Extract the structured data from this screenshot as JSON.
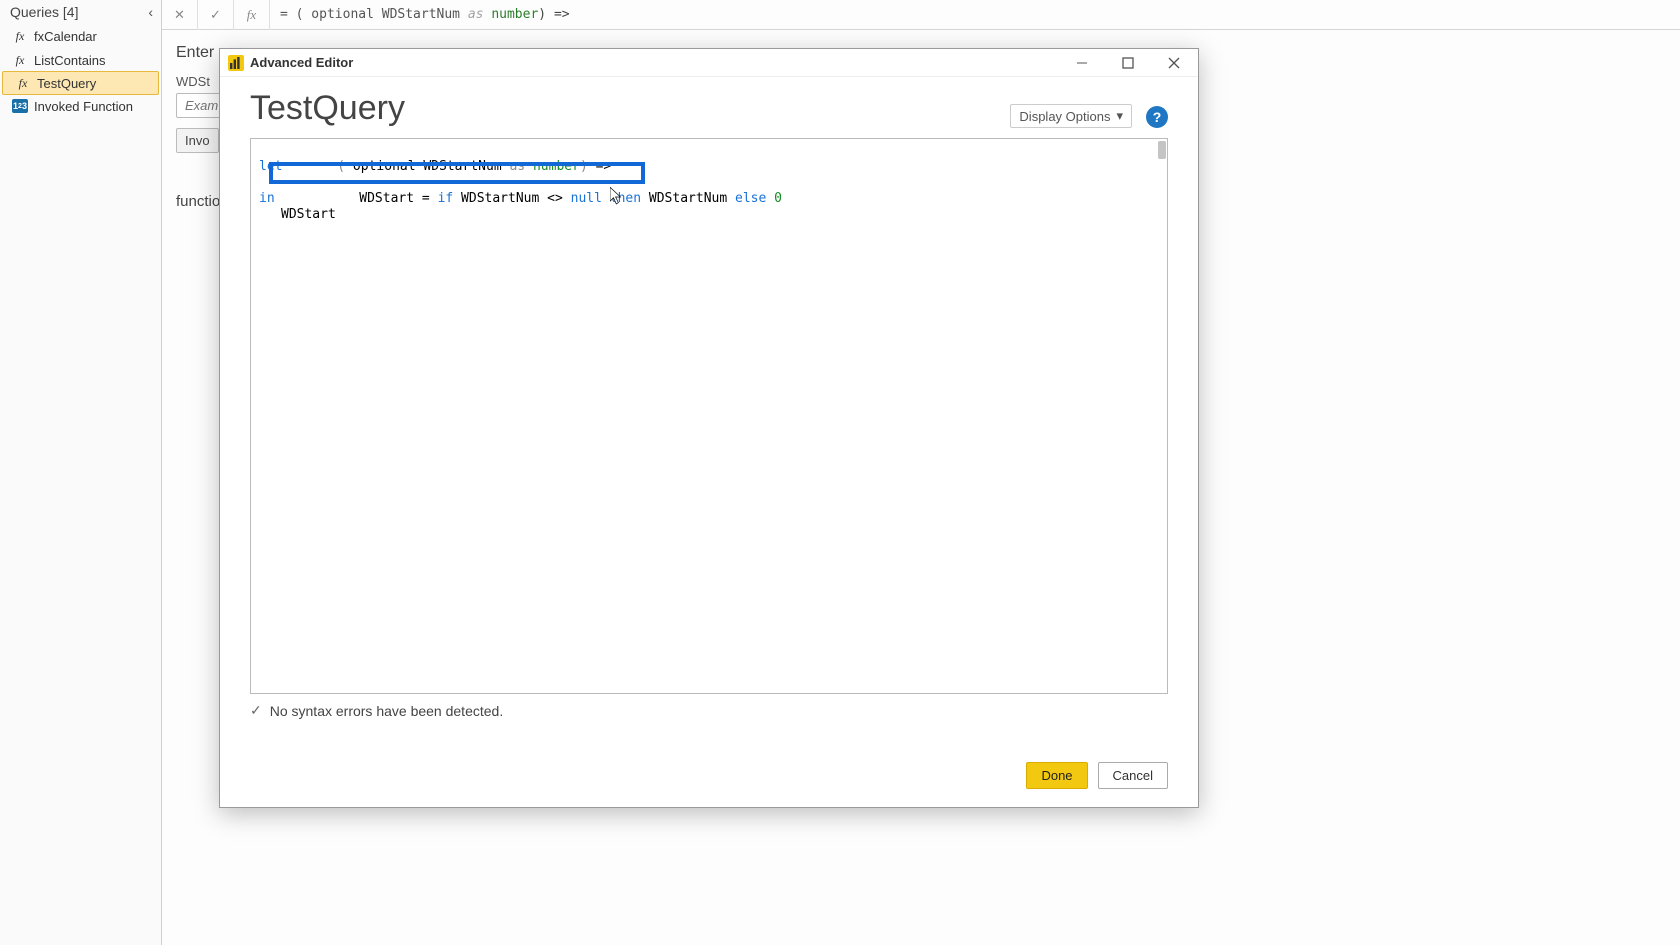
{
  "queries_header": "Queries [4]",
  "queries_items": [
    {
      "icon": "fx",
      "label": "fxCalendar"
    },
    {
      "icon": "fx",
      "label": "ListContains"
    },
    {
      "icon": "fx",
      "label": "TestQuery"
    },
    {
      "icon": "123",
      "label": "Invoked Function"
    }
  ],
  "queries_selected_index": 2,
  "formula_bar": {
    "prefix": "= ( optional WDStartNum ",
    "as": "as",
    "type": " number",
    "suffix": ") =>"
  },
  "behind_form": {
    "heading": "Enter",
    "field_label": "WDSt",
    "placeholder": "Exam",
    "invoke_btn": "Invo",
    "function_label": "function"
  },
  "dialog": {
    "title": "Advanced Editor",
    "query_name": "TestQuery",
    "display_options": "Display Options",
    "status_text": "No syntax errors have been detected.",
    "done": "Done",
    "cancel": "Cancel",
    "code": {
      "l1": {
        "open": "(",
        "body": " optional WDStartNum ",
        "as": "as",
        "type": " number",
        "close": ")",
        "arrow": " =>"
      },
      "l2": "let",
      "l3": {
        "lhs": "WDStart = ",
        "if": "if",
        "mid1": " WDStartNum <> ",
        "null": "null",
        "sp1": " ",
        "then": "then",
        "mid2": " WDStartNum ",
        "else": "else",
        "sp2": " ",
        "zero": "0"
      },
      "l4": "in",
      "l5": "WDStart"
    }
  }
}
